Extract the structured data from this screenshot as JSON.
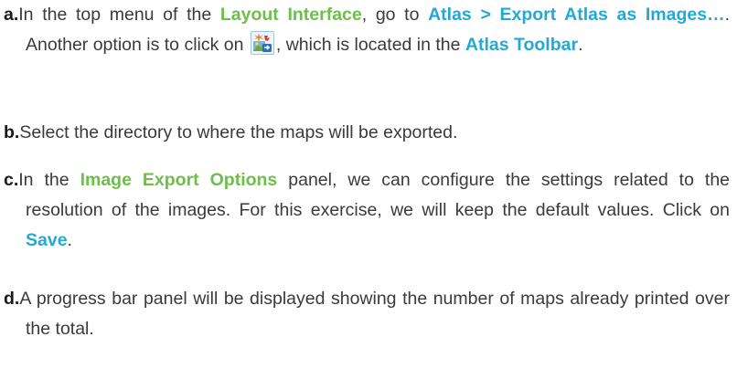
{
  "steps": [
    {
      "marker": "a.",
      "t1": "In the top menu of the ",
      "layout_interface": "Layout Interface",
      "t2": ", go to ",
      "menu_path": "Atlas > Export Atlas as Images…",
      "t3": ". Another option is to click on ",
      "t4": ", which is located in the ",
      "atlas_toolbar": "Atlas Toolbar",
      "t5": "."
    },
    {
      "marker": "b.",
      "text": "Select the directory to where the maps will be exported."
    },
    {
      "marker": "c.",
      "t1": "In the ",
      "panel": "Image Export Options",
      "t2": " panel, we can configure the settings related to the resolution of the images. For this exercise, we will keep the default values. Click on ",
      "save": "Save",
      "t3": "."
    },
    {
      "marker": "d.",
      "text": "A progress bar panel will be displayed showing the number of maps already printed over the total."
    }
  ],
  "icons": {
    "export_atlas": "export-atlas-as-images-icon"
  },
  "colors": {
    "green": "#6dbf4a",
    "cyan": "#23a9d6",
    "text": "#3a3a3a"
  }
}
